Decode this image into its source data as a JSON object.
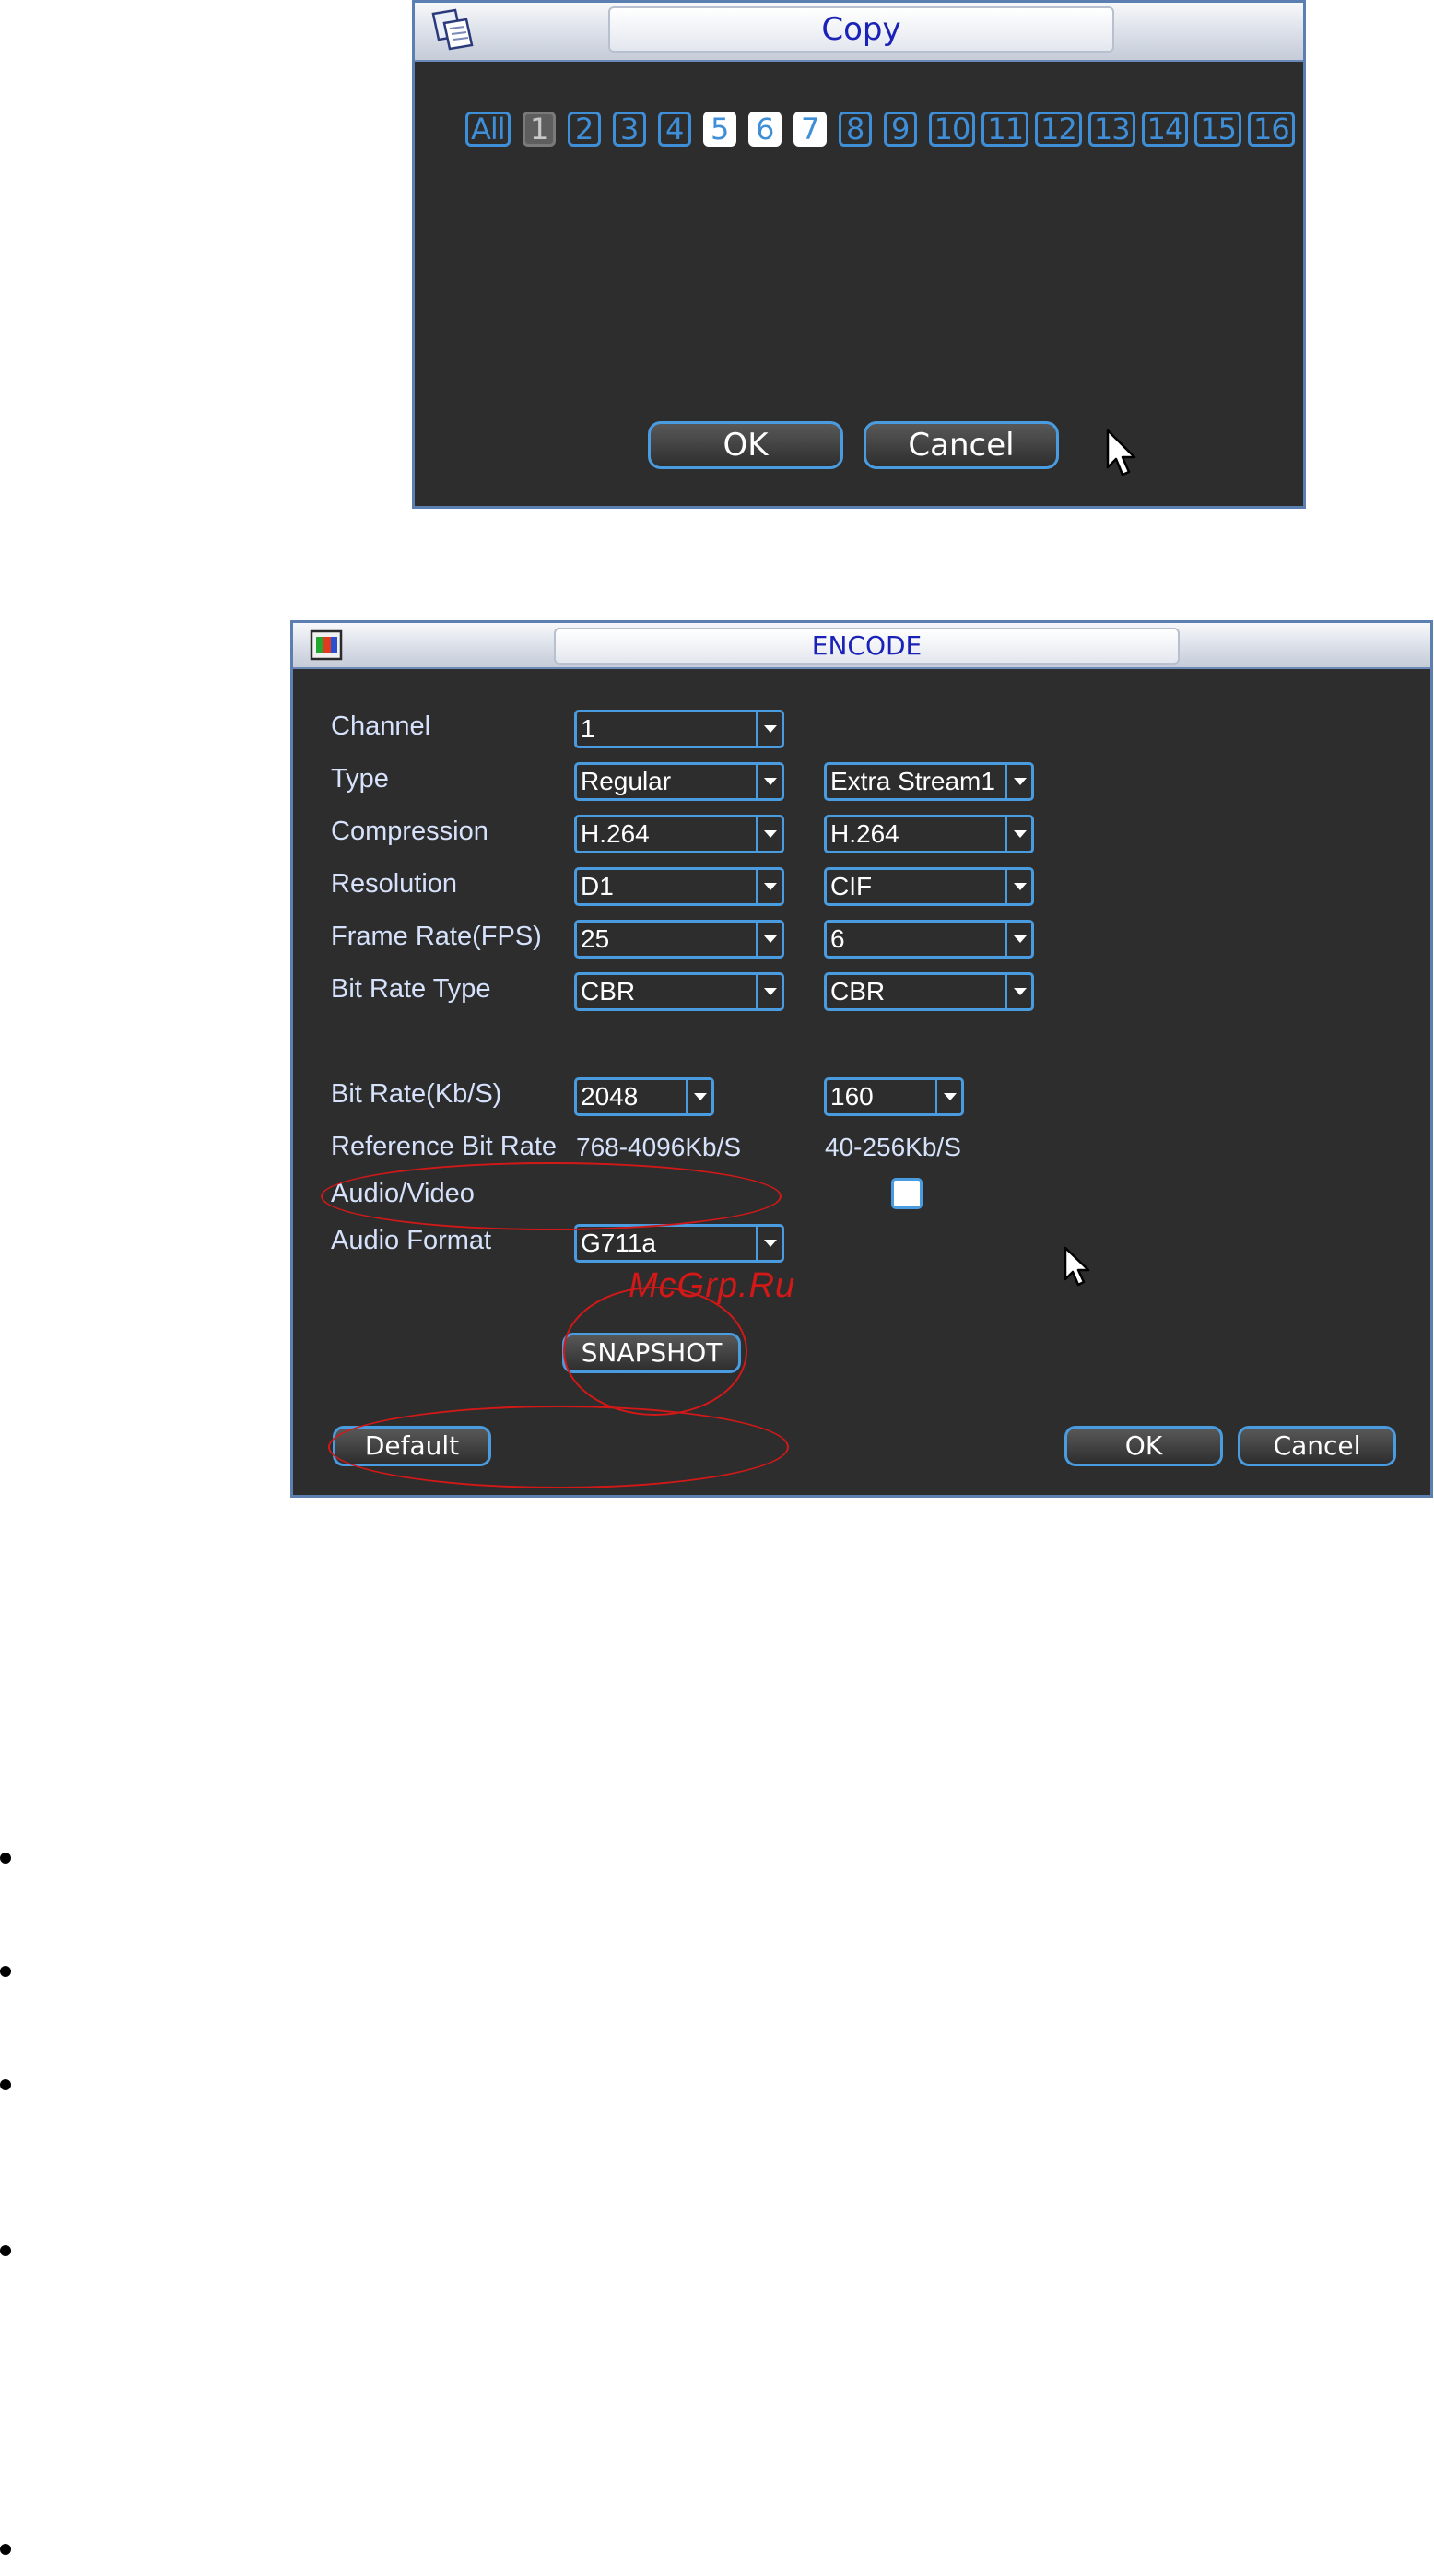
{
  "copy_dialog": {
    "title": "Copy",
    "icon": "copy-pages-icon",
    "channels": [
      {
        "label": "All",
        "state": "normal"
      },
      {
        "label": "1",
        "state": "disabled"
      },
      {
        "label": "2",
        "state": "normal"
      },
      {
        "label": "3",
        "state": "normal"
      },
      {
        "label": "4",
        "state": "normal"
      },
      {
        "label": "5",
        "state": "selected"
      },
      {
        "label": "6",
        "state": "selected"
      },
      {
        "label": "7",
        "state": "selected"
      },
      {
        "label": "8",
        "state": "normal"
      },
      {
        "label": "9",
        "state": "normal"
      },
      {
        "label": "10",
        "state": "normal"
      },
      {
        "label": "11",
        "state": "normal"
      },
      {
        "label": "12",
        "state": "normal"
      },
      {
        "label": "13",
        "state": "normal"
      },
      {
        "label": "14",
        "state": "normal"
      },
      {
        "label": "15",
        "state": "normal"
      },
      {
        "label": "16",
        "state": "normal"
      }
    ],
    "ok_label": "OK",
    "cancel_label": "Cancel"
  },
  "encode_dialog": {
    "title": "ENCODE",
    "icon": "encode-palette-icon",
    "labels": {
      "channel": "Channel",
      "type": "Type",
      "compression": "Compression",
      "resolution": "Resolution",
      "frame_rate": "Frame Rate(FPS)",
      "bit_rate_type": "Bit Rate Type",
      "bit_rate": "Bit Rate(Kb/S)",
      "reference_bit_rate": "Reference Bit Rate",
      "audio_video": "Audio/Video",
      "audio_format": "Audio Format"
    },
    "main_stream": {
      "channel": "1",
      "type": "Regular",
      "compression": "H.264",
      "resolution": "D1",
      "frame_rate": "25",
      "bit_rate_type": "CBR",
      "bit_rate": "2048",
      "reference_bit_rate": "768-4096Kb/S",
      "audio_format": "G711a"
    },
    "extra_stream": {
      "type": "Extra Stream1",
      "compression": "H.264",
      "resolution": "CIF",
      "frame_rate": "6",
      "bit_rate_type": "CBR",
      "bit_rate": "160",
      "reference_bit_rate": "40-256Kb/S",
      "audio_video_checked": false
    },
    "snapshot_label": "SNAPSHOT",
    "default_label": "Default",
    "ok_label": "OK",
    "cancel_label": "Cancel",
    "watermark": "McGrp.Ru"
  },
  "annotation_color": "#d31818",
  "accent_color": "#4a9ce0"
}
